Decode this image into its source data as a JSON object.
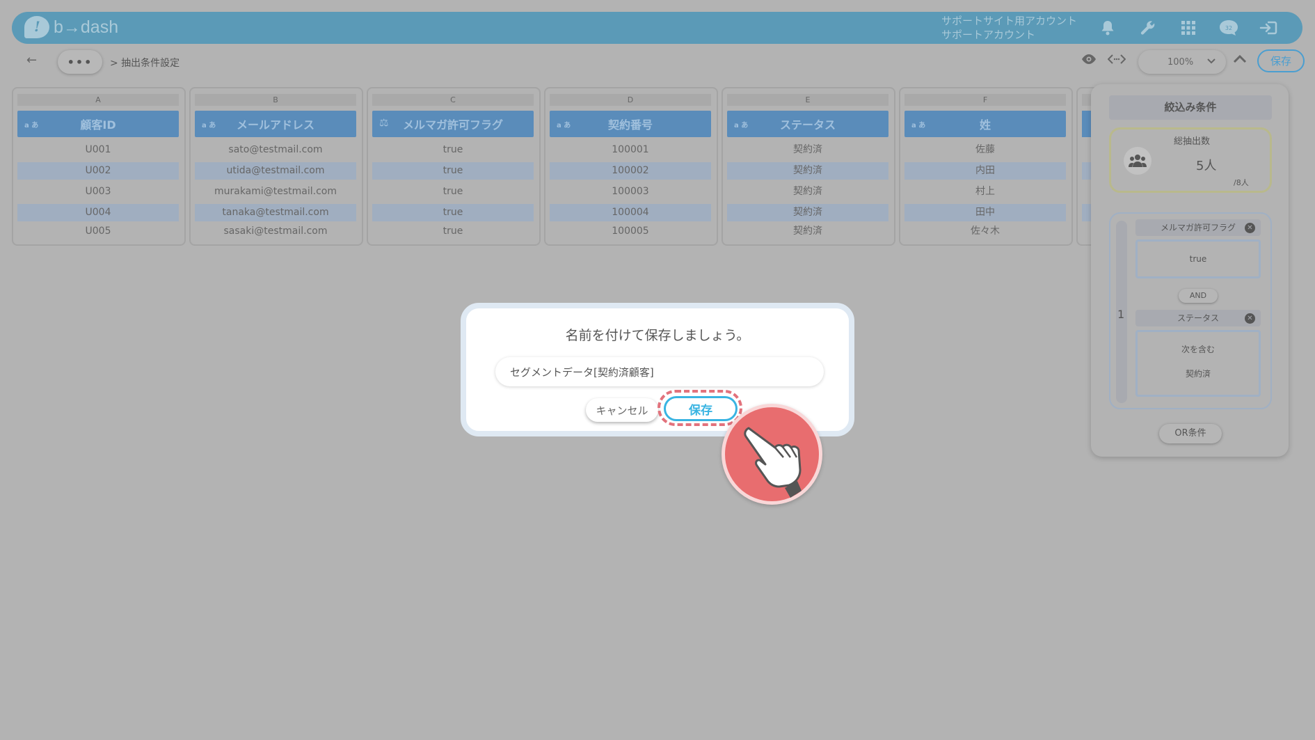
{
  "header": {
    "logo_text": "b→dash",
    "account_line1": "サポートサイト用アカウント",
    "account_line2": "サポートアカウント",
    "icons": [
      "bell-icon",
      "wrench-icon",
      "apps-grid-icon",
      "support-chat-icon",
      "logout-icon"
    ],
    "chat_badge": "32"
  },
  "toolbar": {
    "back": "←",
    "more": "•••",
    "breadcrumb": "> 抽出条件設定",
    "zoom": "100%",
    "save_label": "保存"
  },
  "table": {
    "columns": [
      {
        "letter": "A",
        "type": "a あ",
        "header": "顧客ID",
        "values": [
          "U001",
          "U002",
          "U003",
          "U004",
          "U005"
        ]
      },
      {
        "letter": "B",
        "type": "a あ",
        "header": "メールアドレス",
        "values": [
          "sato@testmail.com",
          "utida@testmail.com",
          "murakami@testmail.com",
          "tanaka@testmail.com",
          "sasaki@testmail.com"
        ]
      },
      {
        "letter": "C",
        "type": "⚖",
        "header": "メルマガ許可フラグ",
        "values": [
          "true",
          "true",
          "true",
          "true",
          "true"
        ]
      },
      {
        "letter": "D",
        "type": "a あ",
        "header": "契約番号",
        "values": [
          "100001",
          "100002",
          "100003",
          "100004",
          "100005"
        ]
      },
      {
        "letter": "E",
        "type": "a あ",
        "header": "ステータス",
        "values": [
          "契約済",
          "契約済",
          "契約済",
          "契約済",
          "契約済"
        ]
      },
      {
        "letter": "F",
        "type": "a あ",
        "header": "姓",
        "values": [
          "佐藤",
          "内田",
          "村上",
          "田中",
          "佐々木"
        ]
      }
    ]
  },
  "panel": {
    "title": "絞込み条件",
    "count_label": "総抽出数",
    "count_value": "5人",
    "count_total": "/8人",
    "group_number": "1",
    "cond1_name": "メルマガ許可フラグ",
    "cond1_value": "true",
    "and_label": "AND",
    "cond2_name": "ステータス",
    "cond2_operator": "次を含む",
    "cond2_value": "契約済",
    "or_label": "OR条件"
  },
  "modal": {
    "title": "名前を付けて保存しましょう。",
    "input_value": "セグメントデータ[契約済顧客]",
    "cancel_label": "キャンセル",
    "save_label": "保存"
  },
  "colors": {
    "header_bg": "#5b9ab7",
    "column_header": "#5a8cba",
    "save_accent": "#39b4e2",
    "highlight_dash": "#e2727c",
    "pointer_bg": "#e86d6f"
  }
}
